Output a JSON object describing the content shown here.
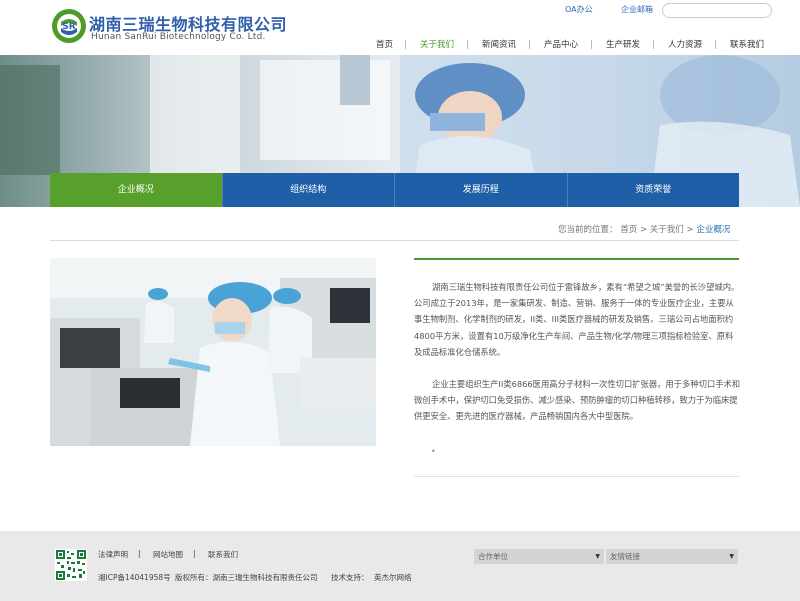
{
  "header": {
    "logo_cn": "湖南三瑞生物科技有限公司",
    "logo_en": "Hunan SanRui Biotechnology Co. Ltd.",
    "logo_mark": "SR",
    "top_links": [
      "OA办公",
      "企业邮箱"
    ],
    "search_placeholder": ""
  },
  "nav": {
    "items": [
      "首页",
      "关于我们",
      "新闻资讯",
      "产品中心",
      "生产研发",
      "人力资源",
      "联系我们"
    ],
    "active": "关于我们"
  },
  "subnav": {
    "tabs": [
      "企业概况",
      "组织结构",
      "发展历程",
      "资质荣誉"
    ],
    "active": "企业概况"
  },
  "breadcrumb": {
    "prefix": "您当前的位置：",
    "items": [
      "首页",
      "关于我们",
      "企业概况"
    ],
    "separator": ">"
  },
  "content": {
    "paragraph1": "湖南三瑞生物科技有限责任公司位于雷锋故乡，素有“希望之城”美誉的长沙望城内。公司成立于2013年，是一家集研发、制造、营销、服务于一体的专业医疗企业，主要从事生物制剂、化学制剂的研发，II类、III类医疗器械的研发及销售。三瑞公司占地面积约4800平方米，设置有10万级净化生产车间、产品生物/化学/物理三项指标检验室、原料及成品标准化仓储系统。",
    "paragraph2": "企业主要组织生产II类6866医用高分子材料一次性切口扩张器，用于多种切口手术和微创手术中，保护切口免受损伤、减少感染、预防肿瘤的切口种植转移，致力于为临床提供更安全、更先进的医疗器械，产品畅销国内各大中型医院。",
    "bullet": "•"
  },
  "footer": {
    "links": [
      "法律声明",
      "网站地图",
      "联系我们"
    ],
    "link_separator": "|",
    "icp": "湘ICP备14041958号",
    "copyright": "版权所有：湖南三瑞生物科技有限责任公司",
    "support": "技术支持：",
    "support_name": "英杰尔网络",
    "select1": "合作单位",
    "select2": "友情链接"
  },
  "colors": {
    "brand_blue": "#1f5fa7",
    "brand_green": "#56a02b",
    "link_blue": "#2c6ab5"
  }
}
